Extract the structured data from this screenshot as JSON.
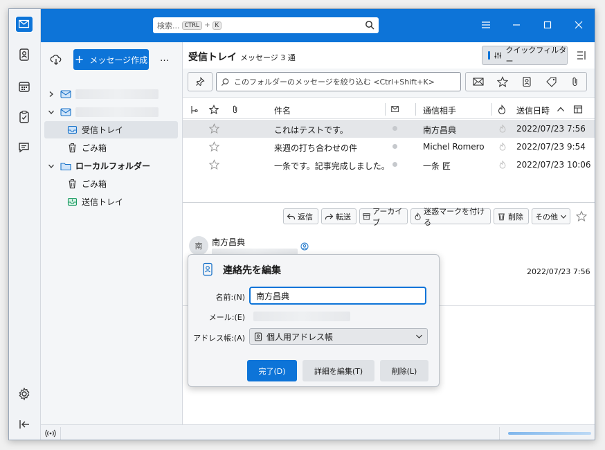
{
  "titlebar": {
    "search_placeholder": "検索...",
    "kbd_ctrl": "CTRL",
    "kbd_plus": "+",
    "kbd_k": "K"
  },
  "folderpane": {
    "new_message": "メッセージ作成",
    "more": "…",
    "account1_children": [
      {
        "label": "受信トレイ"
      },
      {
        "label": "ごみ箱"
      }
    ],
    "local_folder": "ローカルフォルダー",
    "local_children": [
      {
        "label": "ごみ箱"
      },
      {
        "label": "送信トレイ"
      }
    ]
  },
  "listheader": {
    "folder_name": "受信トレイ",
    "count_text": "メッセージ 3 通",
    "quick_filter": "クイックフィルター"
  },
  "filterbar": {
    "placeholder": "このフォルダーのメッセージを絞り込む <Ctrl+Shift+K>"
  },
  "columns": {
    "subject": "件名",
    "correspondent": "通信相手",
    "date": "送信日時"
  },
  "messages": [
    {
      "subject": "これはテストです。",
      "from": "南方昌典",
      "date": "2022/07/23 7:56"
    },
    {
      "subject": "来週の打ち合わせの件",
      "from": "Michel Romero",
      "date": "2022/07/23 9:54"
    },
    {
      "subject": "一条です。記事完成しました。",
      "from": "一条 匠",
      "date": "2022/07/23 10:06"
    }
  ],
  "preview": {
    "reply": "返信",
    "forward": "転送",
    "archive": "アーカイブ",
    "junk": "迷惑マークを付ける",
    "delete": "削除",
    "other": "その他",
    "avatar_initial": "南",
    "sender_name": "南方昌典",
    "date": "2022/07/23 7:56"
  },
  "popup": {
    "title": "連絡先を編集",
    "name_label": "名前:(N)",
    "name_value": "南方昌典",
    "email_label": "メール:(E)",
    "addressbook_label": "アドレス帳:(A)",
    "addressbook_value": "個人用アドレス帳",
    "done": "完了(D)",
    "edit_details": "詳細を編集(T)",
    "delete": "削除(L)"
  },
  "colors": {
    "accent": "#0d74d8"
  }
}
